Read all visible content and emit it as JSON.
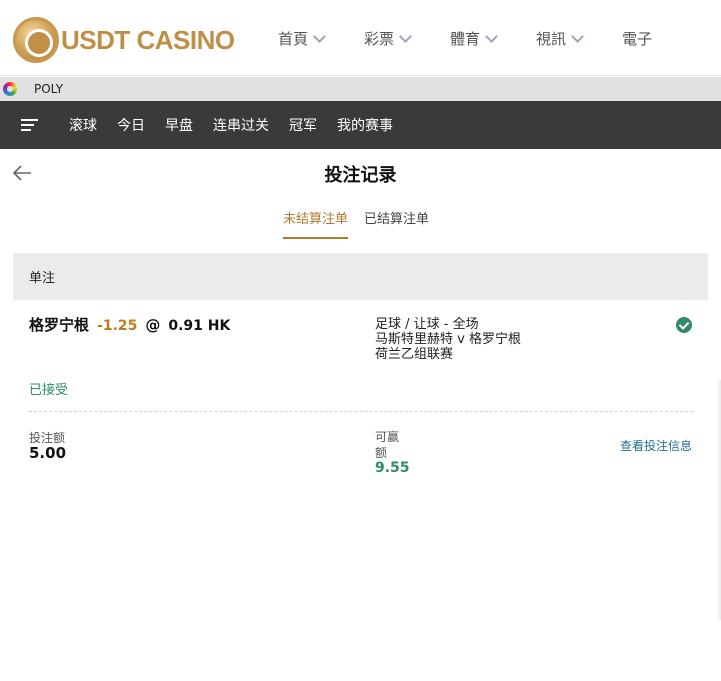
{
  "site": {
    "logo_text": "USDT CASINO",
    "nav": [
      "首頁",
      "彩票",
      "體育",
      "視訊",
      "電子"
    ]
  },
  "poly_bar": {
    "label": "POLY"
  },
  "sport_nav": {
    "tabs": [
      "滚球",
      "今日",
      "早盘",
      "连串过关",
      "冠军",
      "我的赛事"
    ]
  },
  "page": {
    "title": "投注记录",
    "tabs": [
      "未结算注单",
      "已结算注单"
    ],
    "active_tab": "未结算注单"
  },
  "bet": {
    "section_label": "单注",
    "selection": "格罗宁根",
    "handicap": "-1.25",
    "at": "@",
    "odds": "0.91 HK",
    "market": "足球 / 让球 - 全场",
    "match": "马斯特里赫特 v 格罗宁根",
    "league": "荷兰乙组联赛",
    "status": "已接受",
    "stake_label": "投注额",
    "stake": "5.00",
    "win_label": "可赢额",
    "win": "9.55",
    "view_info": "查看投注信息"
  },
  "colors": {
    "accent_gold": "#b07a2d",
    "handicap_orange": "#c27a1e",
    "success_green": "#2e8b6d",
    "nav_dark": "#3a3a3a"
  }
}
